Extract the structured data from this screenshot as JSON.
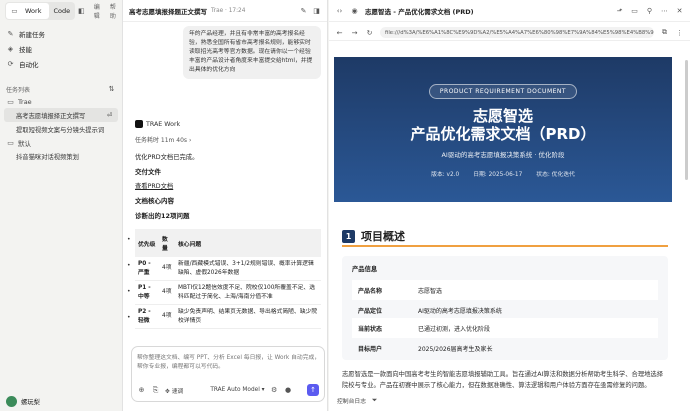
{
  "app": {
    "mode_tabs": [
      "Work",
      "Code"
    ],
    "menu": [
      "编辑",
      "帮助"
    ]
  },
  "sidebar": {
    "nav": [
      {
        "label": "新建任务",
        "icon": "compose-icon"
      },
      {
        "label": "技能",
        "icon": "skills-icon"
      },
      {
        "label": "自动化",
        "icon": "automation-icon"
      }
    ],
    "tasks_header": "任务列表",
    "groups": [
      {
        "name": "Trae",
        "tasks": [
          {
            "label": "高考志愿填报择正文撰写",
            "selected": true,
            "badge": "⏎"
          },
          {
            "label": "提取短视频文案与分镜头提示词",
            "selected": false,
            "badge": ""
          }
        ]
      },
      {
        "name": "默认",
        "tasks": [
          {
            "label": "抖音猫咪对话视频策划",
            "selected": false,
            "badge": ""
          }
        ]
      }
    ],
    "user": "螺玩梨"
  },
  "chat": {
    "title": "高考志愿填报择题正文撰写",
    "subtitle": "Trae · 17:24",
    "user_message": "年的产品经理，并且有非常丰富的高考报名经验，熟悉全国所有省市高考报名规则，能够实时读取招光高考等官方数据。现在请你以一个经验丰富的产品设计者角度来丰富提交给html，并提出具体的优化方向",
    "agent_name": "TRAE Work",
    "duration": "任务耗时 11m 40s",
    "lines": {
      "status": "优化PRD文档已完成。",
      "deliverable_h": "交付文件",
      "deliverable_link": "查看PRD文档",
      "core_h": "文档核心内容",
      "diag_h": "诊断出的12项问题"
    },
    "table": {
      "headers": [
        "优先级",
        "数量",
        "核心问题"
      ],
      "rows": [
        {
          "pri": "P0 - 严重",
          "cnt": "4项",
          "issue": "新疆/西藏模式错误、3+1/2规则错误、概率计算逻辑缺陷、虚假2026年数据"
        },
        {
          "pri": "P1 - 中等",
          "cnt": "4项",
          "issue": "MBTI仅12题信效度不足、院校仅100所覆盖不足、选科匹配过于简化、上海/海南分值不准"
        },
        {
          "pri": "P2 - 轻微",
          "cnt": "4项",
          "issue": "缺少免责声明、结果页无数据、导出格式简陋、缺少院校详情页"
        }
      ]
    },
    "input": {
      "placeholder": "帮你整理这文档、编写 PPT、分析 Excel 每日报，让 Work 自动完成，帮你专业报，编程都可以写代码。",
      "mode": "速调",
      "model": "TRAE Auto Model"
    }
  },
  "preview": {
    "title": "志愿智选 - 产品优化需求文档 (PRD)",
    "url": "file:///d%3A/%E6%A1%8C%E9%9D%A2/%E5%A4%A7%E6%80%98%E7%9A%84%E5%98%E4%B8%9C/Trae/%E5%BF%97%E6%84%BF%E6%99%BA%E9%80%89.html",
    "hero": {
      "pill": "PRODUCT REQUIREMENT DOCUMENT",
      "title1": "志愿智选",
      "title2": "产品优化需求文档（PRD）",
      "subtitle": "AI驱动的高考志愿填报决策系统 · 优化阶段",
      "version": "版本: v2.0",
      "date": "日期: 2025-06-17",
      "state": "状态: 优化迭代"
    },
    "section": {
      "num": "1",
      "title": "项目概述"
    },
    "card": {
      "title": "产品信息",
      "rows": [
        {
          "k": "产品名称",
          "v": "志愿智选"
        },
        {
          "k": "产品定位",
          "v": "AI驱动的高考志愿填报决策系统"
        },
        {
          "k": "当前状态",
          "v": "已通过初测，进入优化阶段"
        },
        {
          "k": "目标用户",
          "v": "2025/2026届高考生及家长"
        }
      ]
    },
    "paragraph": "志愿智选是一款面向中国高考考生的智能志愿填报辅助工具。旨在通过AI算法和数据分析帮助考生科学、合理地选择院校与专业。产品在初赛中展示了核心能力，但在数据准确性、算法逻辑和用户体验方面存在亟需修复的问题。",
    "footer": "控制台日志"
  },
  "colors": {
    "accent": "#5b5bf0",
    "hero_top": "#1e3a66",
    "hero_bottom": "#2b5896",
    "section_rule": "#f0a040"
  }
}
